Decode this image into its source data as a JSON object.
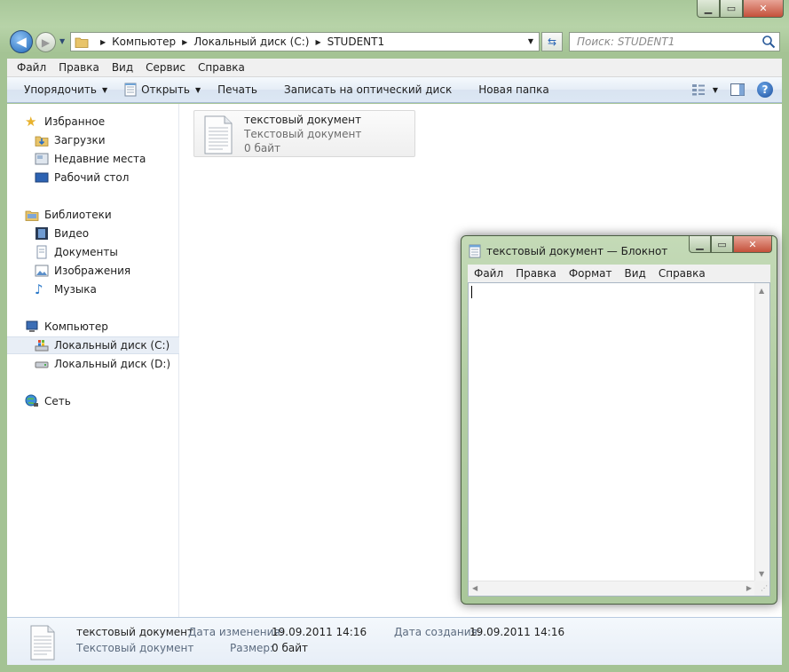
{
  "address": {
    "crumbs": [
      "Компьютер",
      "Локальный диск (C:)",
      "STUDENT1"
    ]
  },
  "search": {
    "placeholder": "Поиск: STUDENT1"
  },
  "menu": [
    "Файл",
    "Правка",
    "Вид",
    "Сервис",
    "Справка"
  ],
  "toolbar": {
    "organize": "Упорядочить",
    "open": "Открыть",
    "print": "Печать",
    "burn": "Записать на оптический диск",
    "new_folder": "Новая папка"
  },
  "nav": {
    "favorites": "Избранное",
    "downloads": "Загрузки",
    "recent_places": "Недавние места",
    "desktop": "Рабочий стол",
    "libraries": "Библиотеки",
    "video": "Видео",
    "documents": "Документы",
    "pictures": "Изображения",
    "music": "Музыка",
    "computer": "Компьютер",
    "local_c": "Локальный диск (C:)",
    "local_d": "Локальный диск (D:)",
    "network": "Сеть"
  },
  "file": {
    "name": "текстовый документ",
    "type": "Текстовый документ",
    "size": "0 байт"
  },
  "details": {
    "name": "текстовый документ",
    "type": "Текстовый документ",
    "modified_label": "Дата изменения:",
    "modified_value": "19.09.2011 14:16",
    "created_label": "Дата создания:",
    "created_value": "19.09.2011 14:16",
    "size_label": "Размер:",
    "size_value": "0 байт"
  },
  "notepad": {
    "title": "текстовый документ — Блокнот",
    "menu": [
      "Файл",
      "Правка",
      "Формат",
      "Вид",
      "Справка"
    ]
  },
  "colors": {
    "window_frame": "#a9c89a",
    "selection": "#e8eef6",
    "accent": "#1f67b8"
  }
}
